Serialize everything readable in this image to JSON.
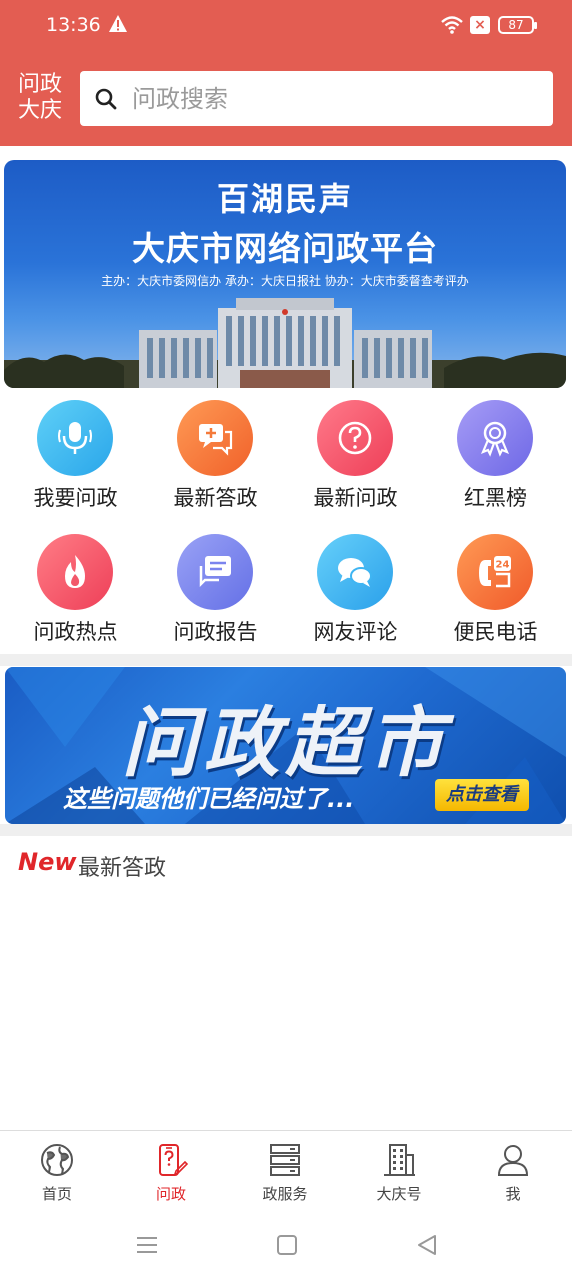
{
  "status": {
    "time": "13:36",
    "battery": "87",
    "icons": [
      "warning-icon",
      "wifi-icon",
      "close-box-icon",
      "battery-icon"
    ]
  },
  "header": {
    "logo_line1": "问政",
    "logo_line2": "大庆"
  },
  "search": {
    "placeholder": "问政搜索",
    "icon": "search-icon"
  },
  "banner": {
    "title1": "百湖民声",
    "title2": "大庆市网络问政平台",
    "subtitle": "主办：大庆市委网信办   承办：大庆日报社   协办：大庆市委督查考评办"
  },
  "grid": [
    {
      "label": "我要问政",
      "icon": "microphone-icon",
      "color": "#3bbbf0"
    },
    {
      "label": "最新答政",
      "icon": "reply-chat-icon",
      "color": "#f47a3a"
    },
    {
      "label": "最新问政",
      "icon": "question-icon",
      "color": "#f25a6e"
    },
    {
      "label": "红黑榜",
      "icon": "award-ribbon-icon",
      "color": "#8a82ee"
    },
    {
      "label": "问政热点",
      "icon": "flame-icon",
      "color": "#f2586a"
    },
    {
      "label": "问政报告",
      "icon": "report-chat-icon",
      "color": "#7b84ee"
    },
    {
      "label": "网友评论",
      "icon": "comments-icon",
      "color": "#3fb5f2"
    },
    {
      "label": "便民电话",
      "icon": "phone-24-icon",
      "color": "#f4743a"
    }
  ],
  "ad": {
    "title": "问政超市",
    "subtitle": "这些问题他们已经问过了...",
    "button": "点击查看"
  },
  "latest": {
    "badge": "New",
    "label": "最新答政"
  },
  "bottom_nav": [
    {
      "label": "首页",
      "icon": "globe-icon",
      "active": false
    },
    {
      "label": "问政",
      "icon": "phone-question-icon",
      "active": true
    },
    {
      "label": "政服务",
      "icon": "server-stack-icon",
      "active": false
    },
    {
      "label": "大庆号",
      "icon": "building-icon",
      "active": false
    },
    {
      "label": "我",
      "icon": "user-icon",
      "active": false
    }
  ],
  "colors": {
    "brand": "#e35d52",
    "active": "#e0262a"
  }
}
